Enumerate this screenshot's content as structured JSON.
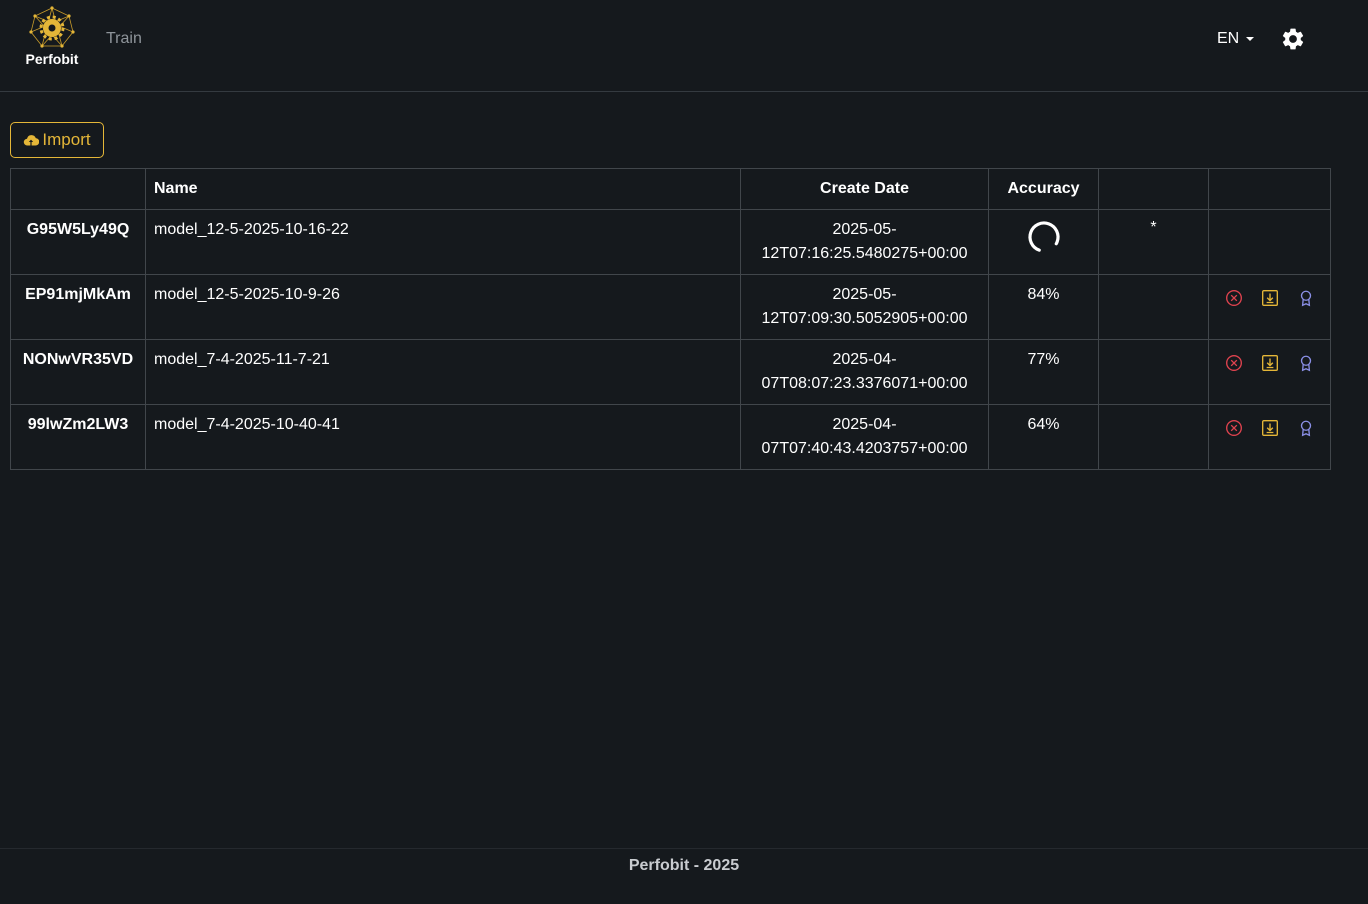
{
  "header": {
    "brand": "Perfobit",
    "nav_link": "Train",
    "language": "EN"
  },
  "toolbar": {
    "import_label": "Import"
  },
  "table": {
    "columns": [
      "",
      "Name",
      "Create Date",
      "Accuracy",
      "",
      ""
    ],
    "rows": [
      {
        "id": "G95W5Ly49Q",
        "name": "model_12-5-2025-10-16-22",
        "date_line1": "2025-05-",
        "date_line2": "12T07:16:25.5480275+00:00",
        "accuracy": "",
        "loading": true,
        "mark": "*",
        "actions": false
      },
      {
        "id": "EP91mjMkAm",
        "name": "model_12-5-2025-10-9-26",
        "date_line1": "2025-05-",
        "date_line2": "12T07:09:30.5052905+00:00",
        "accuracy": "84%",
        "loading": false,
        "mark": "",
        "actions": true
      },
      {
        "id": "NONwVR35VD",
        "name": "model_7-4-2025-11-7-21",
        "date_line1": "2025-04-",
        "date_line2": "07T08:07:23.3376071+00:00",
        "accuracy": "77%",
        "loading": false,
        "mark": "",
        "actions": true
      },
      {
        "id": "99lwZm2LW3",
        "name": "model_7-4-2025-10-40-41",
        "date_line1": "2025-04-",
        "date_line2": "07T07:40:43.4203757+00:00",
        "accuracy": "64%",
        "loading": false,
        "mark": "",
        "actions": true
      }
    ]
  },
  "footer": {
    "text": "Perfobit - 2025"
  },
  "colors": {
    "background": "#15191d",
    "accent": "#e4b638",
    "danger": "#e0434f",
    "info": "#8a8fe6",
    "border": "#41464b"
  },
  "icons": {
    "logo": "network-gear-logo",
    "settings": "gear-icon",
    "import": "cloud-upload-icon",
    "delete": "x-circle-icon",
    "download": "download-box-icon",
    "award": "award-icon",
    "loading": "spinner-icon"
  }
}
